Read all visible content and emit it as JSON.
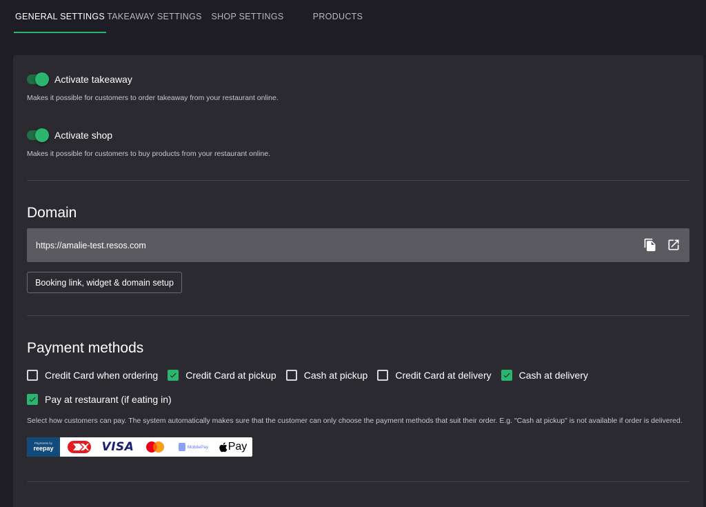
{
  "tabs": [
    {
      "label": "GENERAL SETTINGS",
      "active": true
    },
    {
      "label": "TAKEAWAY SETTINGS",
      "active": false
    },
    {
      "label": "SHOP SETTINGS",
      "active": false
    },
    {
      "label": "PRODUCTS",
      "active": false
    }
  ],
  "toggles": [
    {
      "label": "Activate takeaway",
      "enabled": true,
      "help": "Makes it possible for customers to order takeaway from your restaurant online."
    },
    {
      "label": "Activate shop",
      "enabled": true,
      "help": "Makes it possible for customers to buy products from your restaurant online."
    }
  ],
  "domain": {
    "title": "Domain",
    "value": "https://amalie-test.resos.com",
    "setup_button": "Booking link, widget & domain setup"
  },
  "payment": {
    "title": "Payment methods",
    "methods": [
      {
        "label": "Credit Card when ordering",
        "checked": false
      },
      {
        "label": "Credit Card at pickup",
        "checked": true
      },
      {
        "label": "Cash at pickup",
        "checked": false
      },
      {
        "label": "Credit Card at delivery",
        "checked": false
      },
      {
        "label": "Cash at delivery",
        "checked": true
      },
      {
        "label": "Pay at restaurant (if eating in)",
        "checked": true
      }
    ],
    "help": "Select how customers can pay. The system automatically makes sure that the customer can only choose the payment methods that suit their order. E.g. \"Cash at pickup\" is not available if order is delivered.",
    "logos": {
      "reepay_top": "Payments by",
      "reepay": "reepay",
      "visa": "VISA",
      "mobilepay": "MobilePay",
      "applepay": "Pay"
    }
  },
  "colors": {
    "accent": "#2bb56e",
    "card": "#2b2a31",
    "background": "#1e1c24"
  }
}
